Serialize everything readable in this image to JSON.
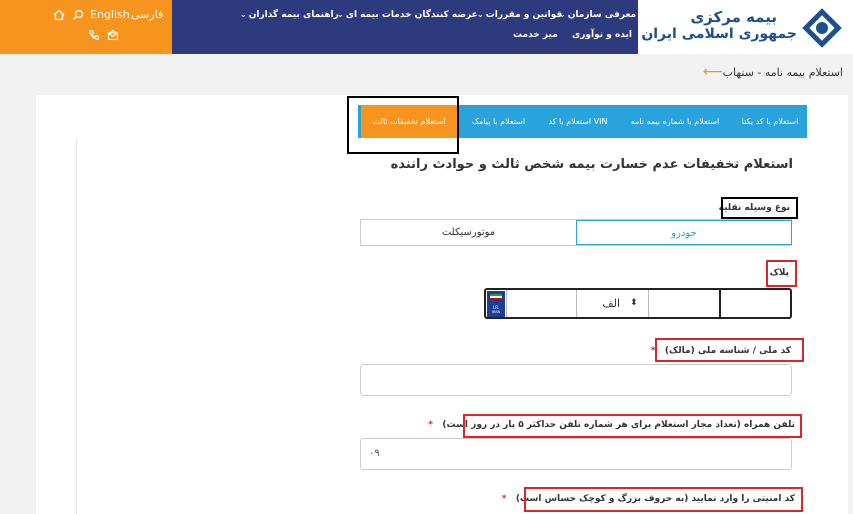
{
  "header": {
    "lang_fa": "فارسی",
    "lang_en": "English",
    "nav_row1": [
      {
        "label": "معرفی سازمان"
      },
      {
        "label": "قوانین و مقررات"
      },
      {
        "label": "عرضه کنندگان خدمات بیمه ای"
      },
      {
        "label": "راهنمای بیمه گذاران"
      }
    ],
    "nav_row2": [
      {
        "label": "ایده و نوآوری"
      },
      {
        "label": "میز خدمت"
      }
    ],
    "logo_line1": "بیمه مرکزی",
    "logo_line2": "جمهوری اسلامی ایران"
  },
  "breadcrumb": "استعلام بیمه نامه - سنهاب",
  "tabs": [
    {
      "label": "استعلام با کد یکتا"
    },
    {
      "label": "استعلام با شماره بیمه نامه"
    },
    {
      "label": "استعلام با کد VIN"
    },
    {
      "label": "استعلام با پیامک"
    },
    {
      "label": "استعلام تخفیفات ثالث"
    }
  ],
  "form": {
    "title": "استعلام تخفیفات عدم خسارت بیمه شخص ثالث و حوادث راننده",
    "vehicle_type_label": "نوع وسیله نقلیه",
    "vehicle_options": [
      "خودرو",
      "موتورسیکلت"
    ],
    "plate_label": "پلاک",
    "plate_letter": "الف",
    "national_id_label": "کد ملی / شناسه ملی (مالک)",
    "phone_label": "تلفن همراه (تعداد مجاز استعلام برای هر شماره تلفن حداکثر ۵ بار در روز است)",
    "phone_value": "۰۹",
    "captcha_label": "کد امنیتی را وارد نمایید (به حروف بزرگ و کوچک حساس است)",
    "required_mark": "*"
  },
  "colors": {
    "accent_orange": "#f7941d",
    "nav_blue": "#2e3a7e",
    "tab_blue": "#29a3d9",
    "required_red": "#d9262a"
  }
}
